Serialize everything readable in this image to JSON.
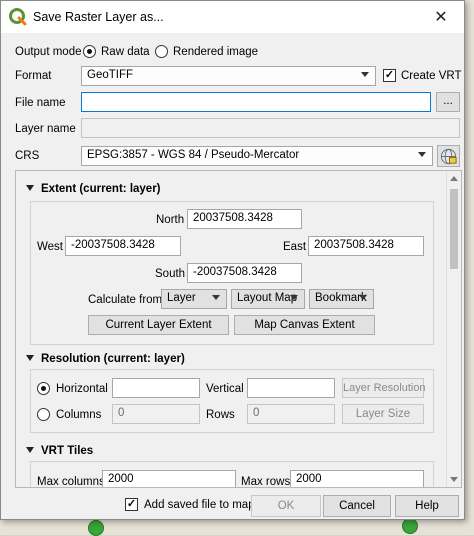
{
  "window": {
    "title": "Save Raster Layer as...",
    "close_glyph": "✕"
  },
  "output_mode": {
    "label": "Output mode",
    "options": [
      "Raw data",
      "Rendered image"
    ],
    "selected": "Raw data"
  },
  "format": {
    "label": "Format",
    "value": "GeoTIFF",
    "create_vrt_label": "Create VRT",
    "create_vrt_checked": true
  },
  "file_name": {
    "label": "File name",
    "value": "",
    "browse_label": "..."
  },
  "layer_name": {
    "label": "Layer name",
    "value": ""
  },
  "crs": {
    "label": "CRS",
    "value": "EPSG:3857 - WGS 84 / Pseudo-Mercator"
  },
  "extent": {
    "header": "Extent (current: layer)",
    "north_label": "North",
    "north": "20037508.3428",
    "west_label": "West",
    "west": "-20037508.3428",
    "east_label": "East",
    "east": "20037508.3428",
    "south_label": "South",
    "south": "-20037508.3428",
    "calculate_from_label": "Calculate from",
    "layer_btn": "Layer",
    "layout_map_btn": "Layout Map",
    "bookmark_btn": "Bookmark",
    "current_layer_extent_btn": "Current Layer Extent",
    "map_canvas_extent_btn": "Map Canvas Extent"
  },
  "resolution": {
    "header": "Resolution (current: layer)",
    "horizontal_label": "Horizontal",
    "horizontal": "",
    "vertical_label": "Vertical",
    "vertical": "",
    "layer_resolution_btn": "Layer Resolution",
    "columns_label": "Columns",
    "columns": "0",
    "rows_label": "Rows",
    "rows": "0",
    "layer_size_btn": "Layer Size",
    "selected": "Horizontal"
  },
  "vrt_tiles": {
    "header": "VRT Tiles",
    "max_columns_label": "Max columns",
    "max_columns": "2000",
    "max_rows_label": "Max rows",
    "max_rows": "2000"
  },
  "footer": {
    "add_saved_label": "Add saved file to map",
    "add_saved_checked": true,
    "ok": "OK",
    "cancel": "Cancel",
    "help": "Help"
  },
  "colors": {
    "focus": "#0a78d7",
    "dialog_bg": "#f0f0f0",
    "qgis_green": "#589632",
    "qgis_yellow": "#ee7913"
  },
  "icons": {
    "app": "qgis-logo-icon",
    "crs_select": "globe-icon"
  }
}
